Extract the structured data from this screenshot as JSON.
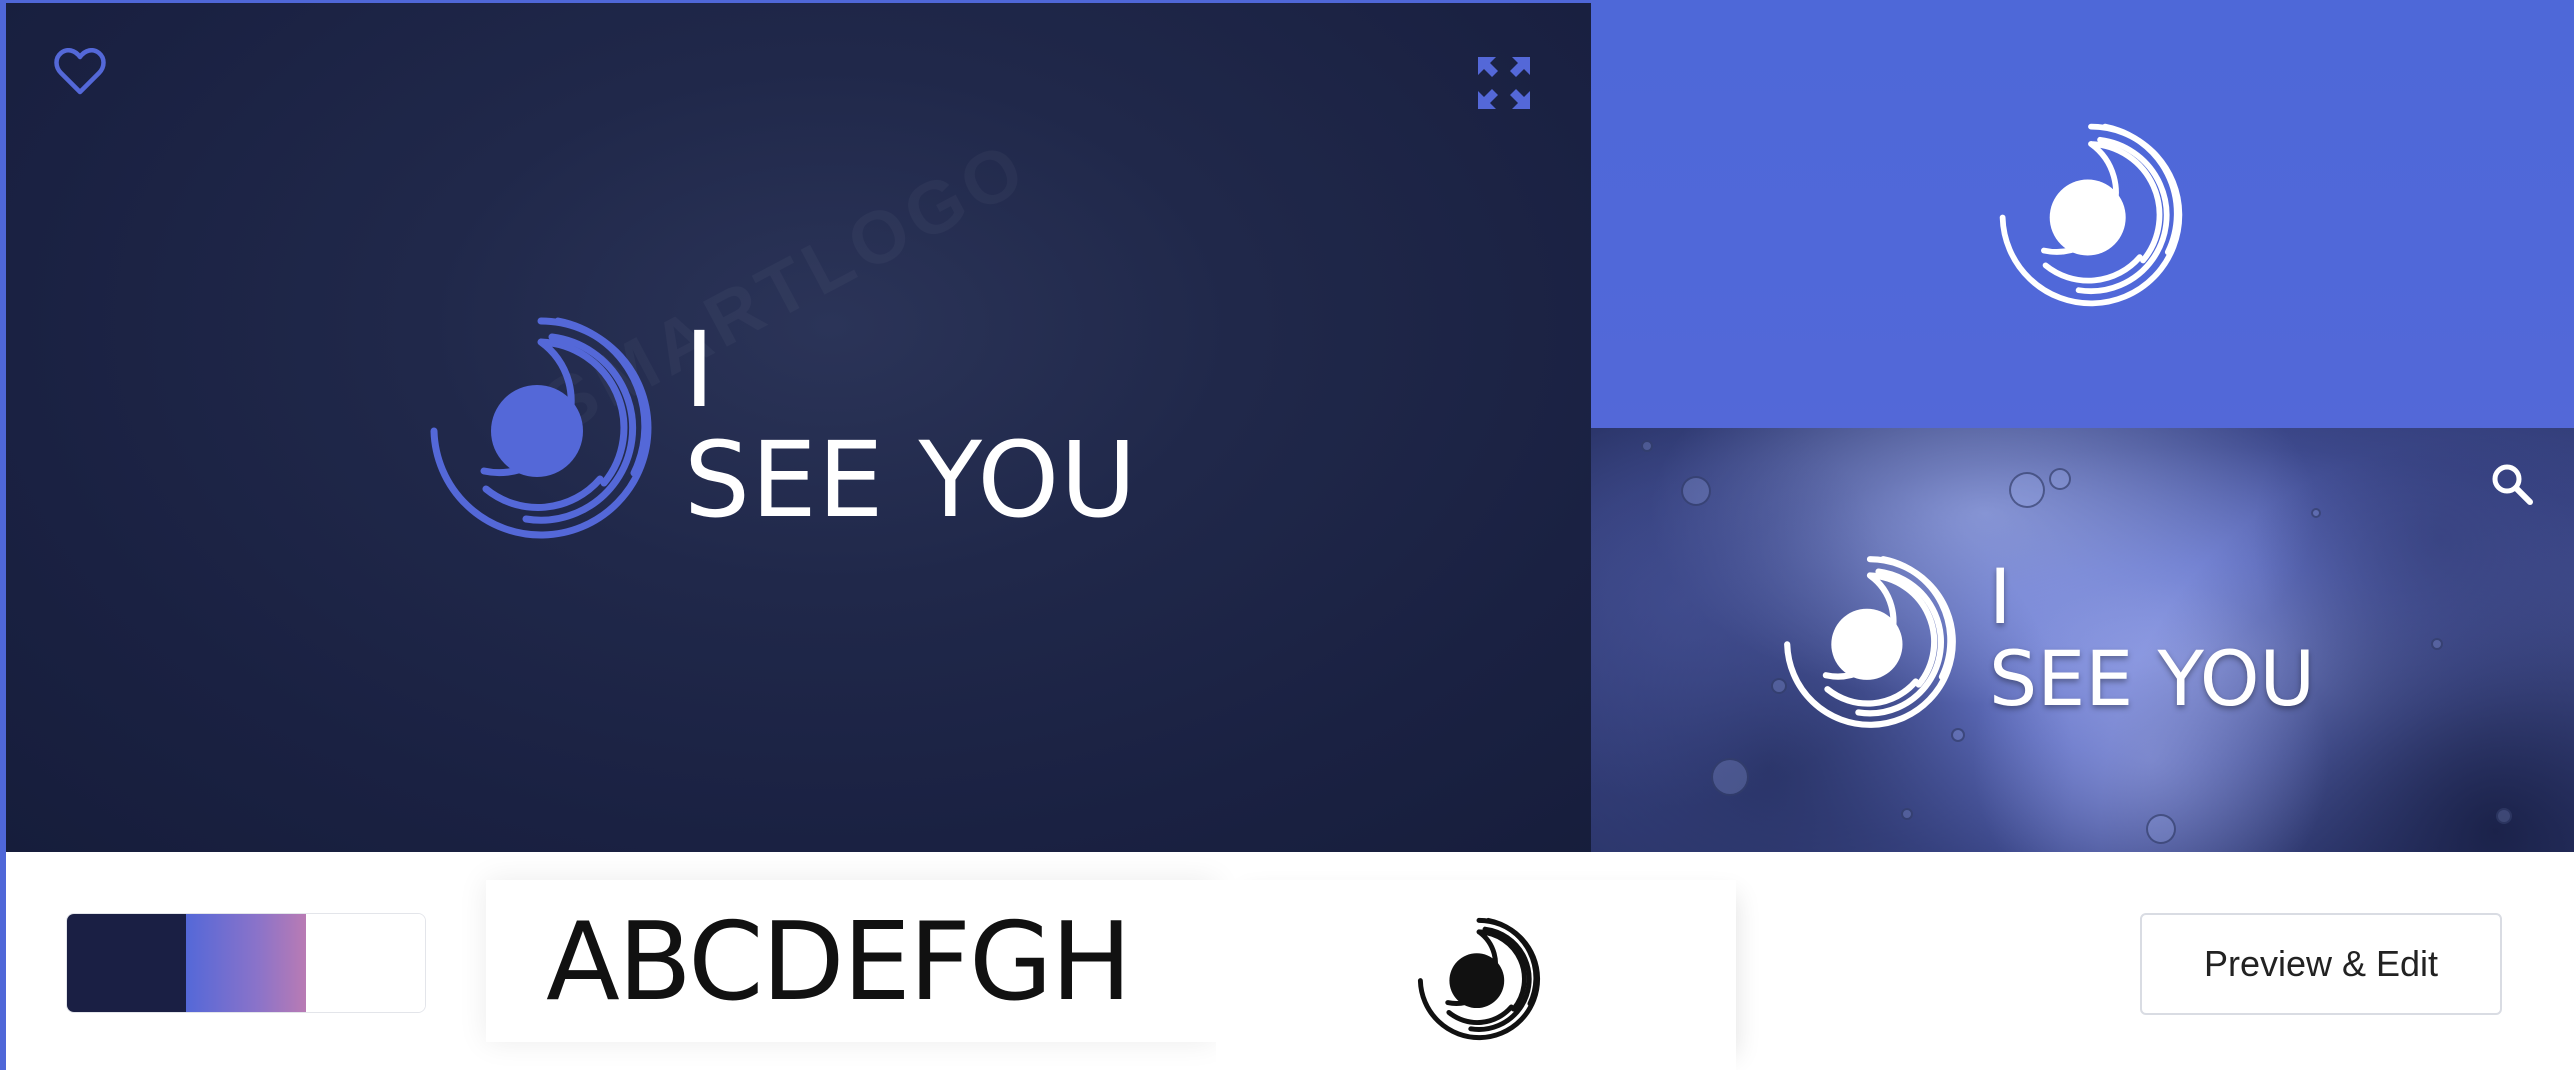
{
  "colors": {
    "primary": "#1a1f44",
    "accent": "#5468d8",
    "accent_gradient_end": "#b97bb4",
    "background_light": "#ffffff"
  },
  "main_preview": {
    "wordmark_line1": "I",
    "wordmark_line2": "SEE YOU",
    "icons": [
      "heart-icon",
      "expand-icon"
    ]
  },
  "photo_mockup": {
    "wordmark_line1": "I",
    "wordmark_line2": "SEE YOU",
    "icons": [
      "search-icon"
    ]
  },
  "bottom_strip": {
    "palette": [
      "#1a1f44",
      "#5468d8-to-#b97bb4",
      "#ffffff"
    ],
    "font_sample": "ABCDEFGH",
    "preview_button_label": "Preview & Edit"
  }
}
